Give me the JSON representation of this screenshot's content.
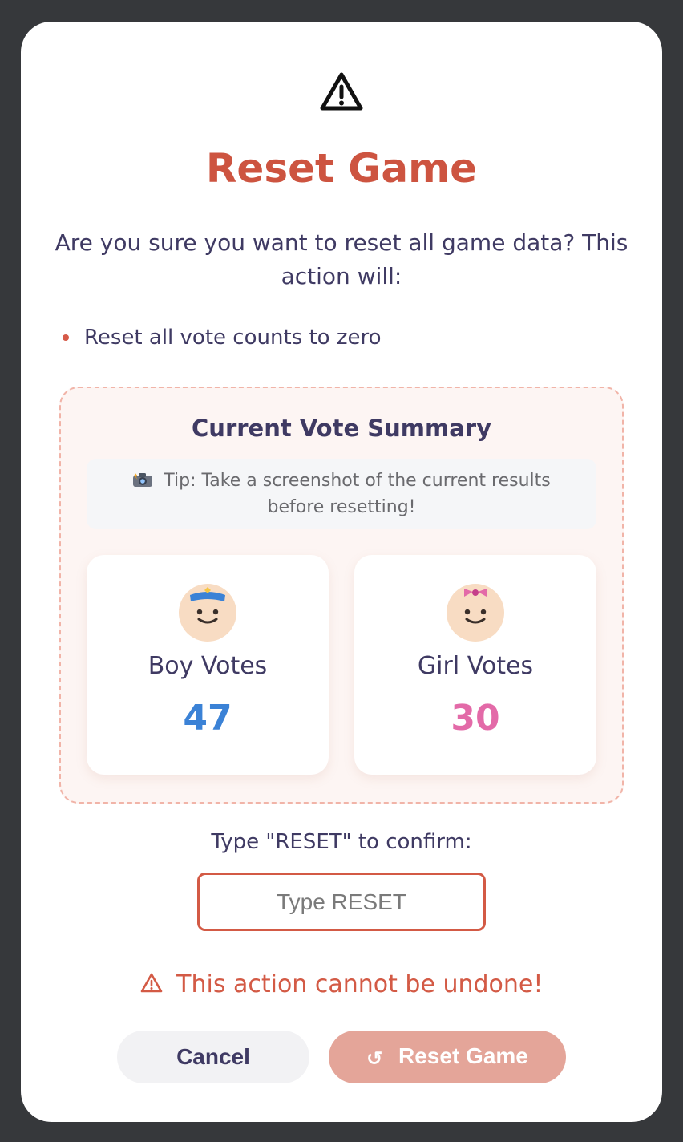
{
  "modal": {
    "warning_icon": "warning-triangle-icon",
    "title": "Reset Game",
    "question": "Are you sure you want to reset all game data? This action will:",
    "bullets": [
      "Reset all vote counts to zero"
    ]
  },
  "summary": {
    "title": "Current Vote Summary",
    "tip_icon": "camera-flash-icon",
    "tip": "Tip: Take a screenshot of the current results before resetting!",
    "boy": {
      "icon": "baby-boy-icon",
      "label": "Boy Votes",
      "count": "47",
      "color": "#3b82d6"
    },
    "girl": {
      "icon": "baby-girl-icon",
      "label": "Girl Votes",
      "count": "30",
      "color": "#e36aa8"
    }
  },
  "confirmation": {
    "label": "Type \"RESET\" to confirm:",
    "placeholder": "Type RESET",
    "value": "",
    "warning": "This action cannot be undone!"
  },
  "buttons": {
    "cancel": "Cancel",
    "reset": "Reset Game",
    "reset_icon": "refresh-icon"
  },
  "colors": {
    "accent": "#cd5440",
    "text": "#3f3a63",
    "reset_button": "#e4a599"
  }
}
